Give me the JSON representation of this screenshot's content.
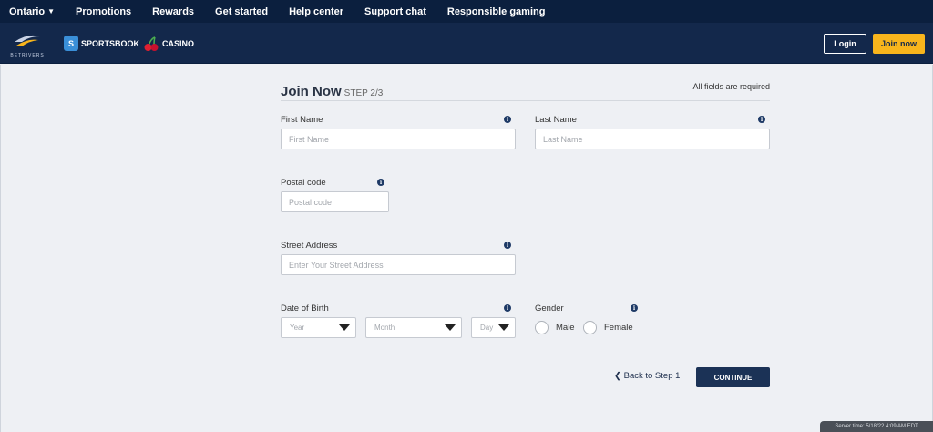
{
  "topnav": {
    "items": [
      "Ontario",
      "Promotions",
      "Rewards",
      "Get started",
      "Help center",
      "Support chat",
      "Responsible gaming"
    ]
  },
  "header": {
    "logo_text": "BETRIVERS",
    "sb_badge": "S",
    "sportsbook_label": "SPORTSBOOK",
    "casino_label": "CASINO",
    "login_label": "Login",
    "join_label": "Join now"
  },
  "form": {
    "title": "Join Now",
    "step": "STEP 2/3",
    "required_note": "All fields are required",
    "first_name": {
      "label": "First Name",
      "placeholder": "First Name"
    },
    "last_name": {
      "label": "Last Name",
      "placeholder": "Last Name"
    },
    "postal_code": {
      "label": "Postal code",
      "placeholder": "Postal code"
    },
    "street": {
      "label": "Street Address",
      "placeholder": "Enter Your Street Address"
    },
    "dob": {
      "label": "Date of Birth",
      "year": "Year",
      "month": "Month",
      "day": "Day"
    },
    "gender": {
      "label": "Gender",
      "male": "Male",
      "female": "Female"
    },
    "back_label": "Back to Step 1",
    "continue_label": "CONTINUE"
  },
  "server_time": "Server time: 5/18/22 4:09 AM EDT",
  "colors": {
    "nav": "#0b1f3e",
    "header": "#13284b",
    "accent": "#f8b51c",
    "button": "#1b3256"
  }
}
